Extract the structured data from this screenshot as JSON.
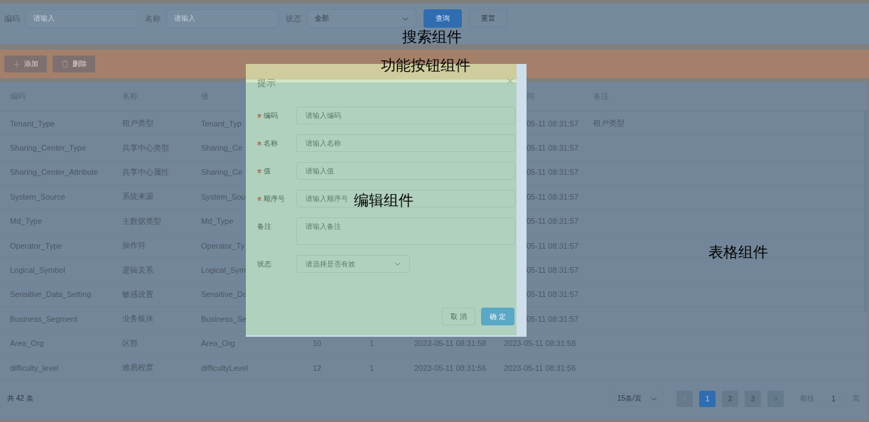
{
  "search": {
    "fields": [
      {
        "label": "编码",
        "kind": "input",
        "placeholder": "请输入"
      },
      {
        "label": "名称",
        "kind": "input",
        "placeholder": "请输入"
      },
      {
        "label": "状态",
        "kind": "select",
        "value": "全部"
      }
    ],
    "buttons": [
      {
        "label": "查询",
        "kind": "primary"
      },
      {
        "label": "重置",
        "kind": "default"
      }
    ]
  },
  "toolbar": {
    "buttons": [
      {
        "label": "添加",
        "kind": "add"
      },
      {
        "label": "删除",
        "kind": "delete"
      }
    ]
  },
  "table": {
    "header": {
      "code": "编码",
      "name": "名称",
      "value": "值",
      "updated": "间",
      "remark": "备注"
    },
    "rows": [
      {
        "code": "Tenant_Type",
        "name": "租户类型",
        "value": "Tenant_Typ",
        "updated": "05-11 08:31:57",
        "remark": "租户类型"
      },
      {
        "code": "Sharing_Center_Type",
        "name": "共享中心类型",
        "value": "Sharing_Ce",
        "updated": "05-11 08:31:57"
      },
      {
        "code": "Sharing_Center_Attribute",
        "name": "共享中心属性",
        "value": "Sharing_Ce",
        "updated": "05-11 08:31:57"
      },
      {
        "code": "System_Source",
        "name": "系统来源",
        "value": "System_Sou",
        "updated": "05-11 08:31:57"
      },
      {
        "code": "Md_Type",
        "name": "主数据类型",
        "value": "Md_Type",
        "updated": "05-11 08:31:57"
      },
      {
        "code": "Operator_Type",
        "name": "操作符",
        "value": "Operator_Ty",
        "updated": "05-11 08:31:57"
      },
      {
        "code": "Logical_Symbol",
        "name": "逻辑关系",
        "value": "Logical_Sym",
        "updated": "05-11 08:31:57"
      },
      {
        "code": "Sensitive_Data_Setting",
        "name": "敏感设置",
        "value": "Sensitive_Da",
        "updated": "05-11 08:31:57"
      },
      {
        "code": "Business_Segment",
        "name": "业务板块",
        "value": "Business_Se",
        "updated": "05-11 08:31:57"
      },
      {
        "code": "Area_Org",
        "name": "区部",
        "value": "Area_Org",
        "sort": "10",
        "status": "1",
        "created": "2023-05-11 08:31:58",
        "updated": "2023-05-11 08:31:58"
      },
      {
        "code": "difficulty_level",
        "name": "难易程度",
        "value": "difficultyLevel",
        "sort": "12",
        "status": "1",
        "created": "2023-05-11 08:31:56",
        "updated": "2023-05-11 08:31:56"
      }
    ]
  },
  "pagination": {
    "total": "共 42 条",
    "page_size": "15条/页",
    "prev_disabled": true,
    "pages": [
      {
        "label": "1",
        "selected": true
      },
      {
        "label": "2",
        "selected": false
      },
      {
        "label": "3",
        "selected": false
      }
    ],
    "next_disabled": false,
    "jump_label": "前往",
    "jump_value": "1",
    "jump_suffix": "页"
  },
  "dialog": {
    "title": "提示",
    "fields": [
      {
        "label": "编码",
        "required": true,
        "kind": "input",
        "placeholder": "请输入编码"
      },
      {
        "label": "名称",
        "required": true,
        "kind": "input",
        "placeholder": "请输入名称"
      },
      {
        "label": "值",
        "required": true,
        "kind": "input",
        "placeholder": "请输入值"
      },
      {
        "label": "顺序号",
        "required": true,
        "kind": "input",
        "placeholder": "请输入顺序号"
      },
      {
        "label": "备注",
        "required": false,
        "kind": "textarea",
        "placeholder": "请输入备注"
      },
      {
        "label": "状态",
        "required": false,
        "kind": "select",
        "placeholder": "请选择是否有效"
      }
    ],
    "buttons": [
      {
        "label": "取 消",
        "kind": "default"
      },
      {
        "label": "确 定",
        "kind": "primary"
      }
    ]
  },
  "annotations": [
    {
      "text": "搜索组件"
    },
    {
      "text": "功能按钮组件"
    },
    {
      "text": "编辑组件"
    },
    {
      "text": "表格组件"
    }
  ]
}
